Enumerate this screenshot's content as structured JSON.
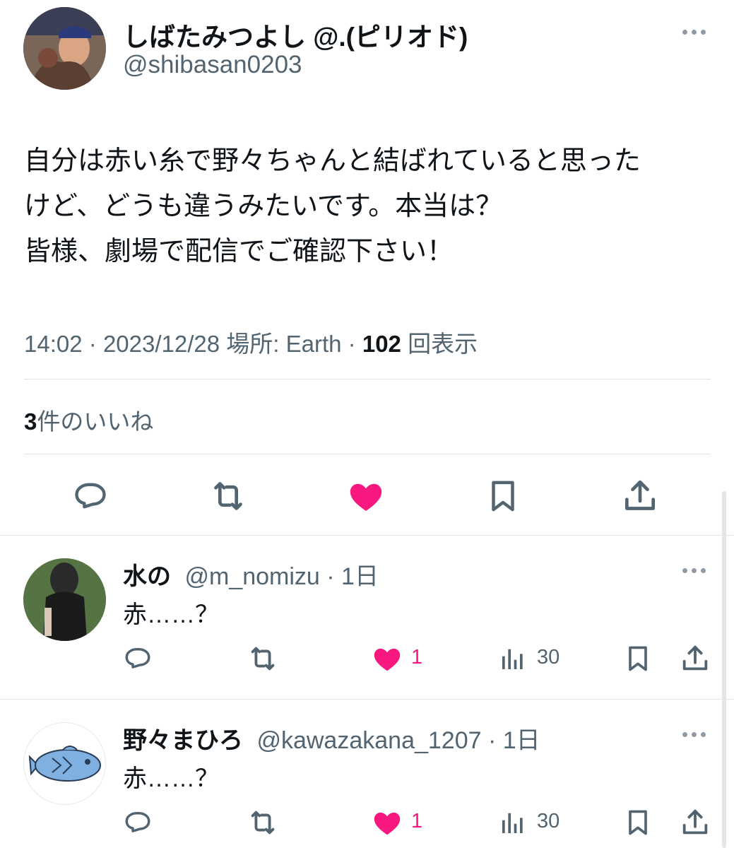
{
  "tweet": {
    "author_name": "しばたみつよし @.(ピリオド)",
    "author_handle": "@shibasan0203",
    "body_lines": [
      "自分は赤い糸で野々ちゃんと結ばれていると思った",
      "けど、どうも違うみたいです。本当は？",
      "皆様、劇場で配信でご確認下さい！"
    ],
    "time": "14:02",
    "date": "2023/12/28",
    "location_label": "場所: Earth",
    "view_count": "102",
    "view_label": "回表示",
    "like_count": "3",
    "like_label": "件のいいね"
  },
  "replies": [
    {
      "name": "水の",
      "handle": "@m_nomizu",
      "age": "1日",
      "text": "赤……？",
      "likes": "1",
      "views": "30"
    },
    {
      "name": "野々まひろ",
      "handle": "@kawazakana_1207",
      "age": "1日",
      "text": "赤……？",
      "likes": "1",
      "views": "30"
    }
  ],
  "colors": {
    "like": "#f91880",
    "text": "#0f1419",
    "muted": "#536471",
    "fish": "#7fb0e0"
  },
  "icons": [
    "more-icon",
    "reply-icon",
    "retweet-icon",
    "like-icon",
    "bookmark-icon",
    "share-icon",
    "views-icon"
  ]
}
